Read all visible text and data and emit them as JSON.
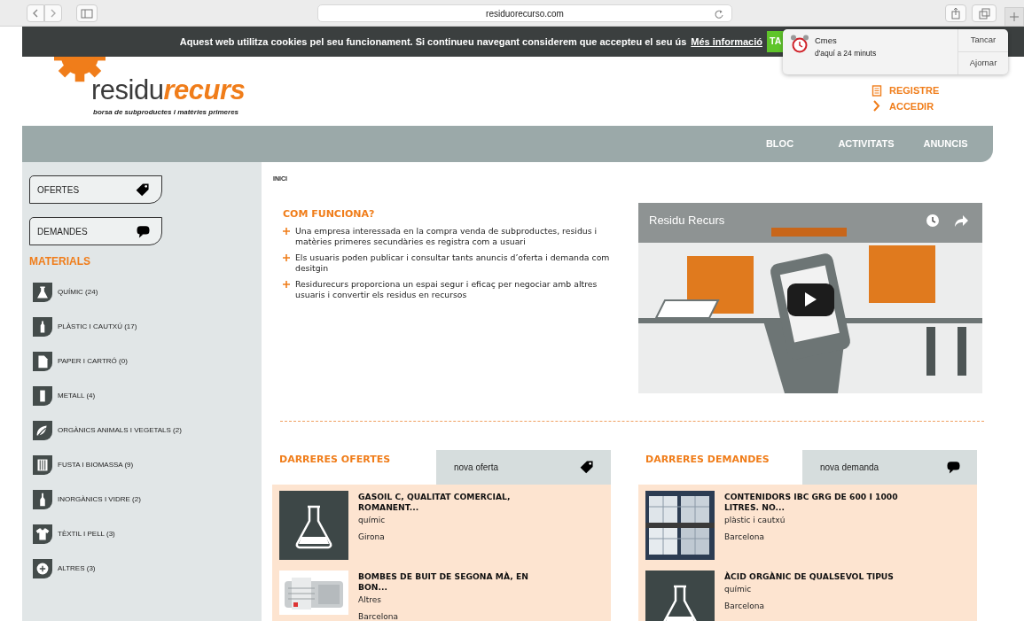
{
  "browser": {
    "address": "residuorecurso.com"
  },
  "cookie_bar": {
    "text": "Aquest web utilitza cookies pel seu funcionament. Si continueu navegant considerem que accepteu el seu ús",
    "link": "Més informació",
    "button": "TA"
  },
  "notification": {
    "title": "Cmes",
    "subtitle": "d'aquí a 24 minuts",
    "actions": [
      "Tancar",
      "Ajornar"
    ]
  },
  "logo": {
    "name_parts": [
      "residu",
      "recurs"
    ],
    "tagline": "borsa de subproductes i matèries primeres"
  },
  "account_links": [
    {
      "label": "REGISTRE",
      "kind": "register"
    },
    {
      "label": "ACCEDIR",
      "kind": "login"
    }
  ],
  "nav": [
    {
      "label": "BLOC"
    },
    {
      "label": "ACTIVITATS"
    },
    {
      "label": "ANUNCIS"
    }
  ],
  "sidebar": {
    "buttons": [
      {
        "label": "OFERTES",
        "kind": "tag"
      },
      {
        "label": "DEMANDES",
        "kind": "speech"
      }
    ],
    "materials_title": "MATERIALS",
    "materials": [
      {
        "label": "QUÍMIC (24)",
        "kind": "chemical"
      },
      {
        "label": "PLÀSTIC I CAUTXÚ (17)",
        "kind": "plastic"
      },
      {
        "label": "PAPER I CARTRÓ (0)",
        "kind": "paper"
      },
      {
        "label": "METALL (4)",
        "kind": "metal"
      },
      {
        "label": "ORGÀNICS ANIMALS I VEGETALS (2)",
        "kind": "organic"
      },
      {
        "label": "FUSTA I BIOMASSA (9)",
        "kind": "wood"
      },
      {
        "label": "INORGÀNICS I VIDRE (2)",
        "kind": "glass"
      },
      {
        "label": "TÈXTIL I PELL (3)",
        "kind": "textile"
      },
      {
        "label": "ALTRES (3)",
        "kind": "other"
      }
    ]
  },
  "breadcrumb": "INICI",
  "how_it_works": {
    "title": "COM FUNCIONA?",
    "points": [
      "Una empresa interessada en la compra venda de subproductes, residus i matèries primeres secundàries es registra com a usuari",
      "Els usuaris poden publicar i consultar tants anuncis d’oferta i demanda com desitgin",
      "Residurecurs proporciona un espai segur i eficaç per negociar amb altres usuaris i convertir els residus en recursos"
    ]
  },
  "video": {
    "kind": "picture",
    "title": "Residu Recurs"
  },
  "lists": [
    {
      "title": "DARRERES OFERTES",
      "button": "nova oferta",
      "kind": "offers",
      "items": [
        {
          "title": "GASOIL C, QUALITAT COMERCIAL, ROMANENT...",
          "category": "químic",
          "city": "Girona",
          "kind": "chemical"
        },
        {
          "title": "BOMBES DE BUIT DE SEGONA MÀ, EN BON...",
          "category": "Altres",
          "city": "Barcelona",
          "kind": "picture"
        }
      ]
    },
    {
      "title": "DARRERES DEMANDES",
      "button": "nova demanda",
      "kind": "requests",
      "items": [
        {
          "title": "CONTENIDORS IBC GRG DE 600 I 1000 LITRES. NO...",
          "category": "plàstic i cautxú",
          "city": "Barcelona",
          "kind": "picture"
        },
        {
          "title": "ÀCID ORGÀNIC DE QUALSEVOL TIPUS",
          "category": "químic",
          "city": "Barcelona",
          "kind": "chemical"
        }
      ]
    }
  ]
}
